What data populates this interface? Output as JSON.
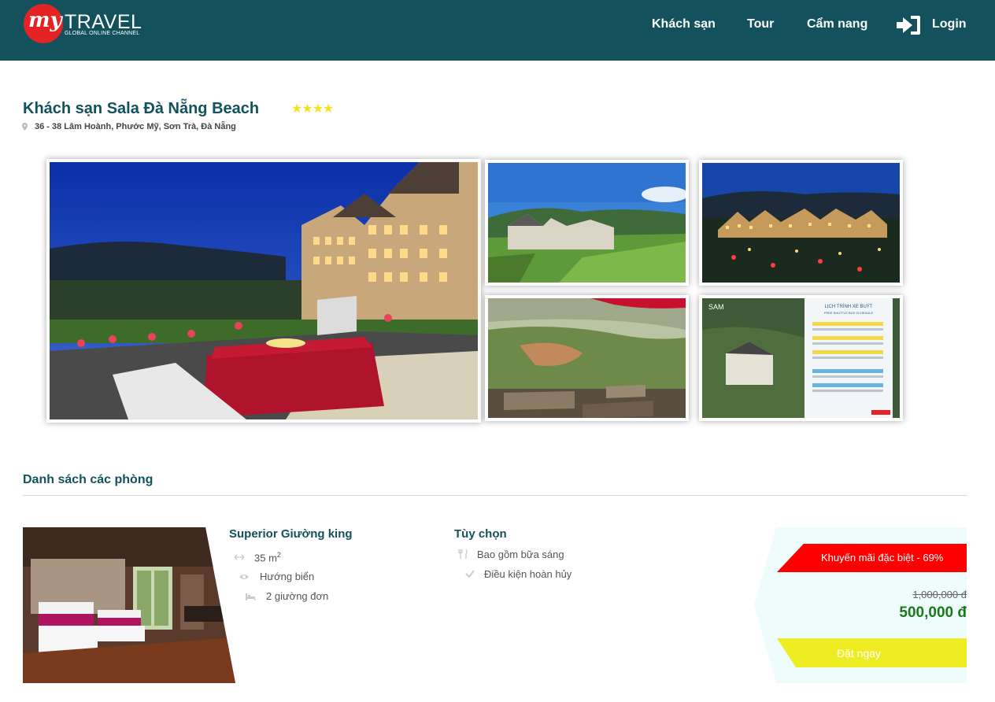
{
  "header": {
    "logo": {
      "my": "my",
      "travel": "TRAVEL",
      "tagline": "GLOBAL ONLINE CHANNEL"
    },
    "nav": {
      "hotels": "Khách sạn",
      "tours": "Tour",
      "guide": "Cẩm nang",
      "login": "Login"
    },
    "colors": {
      "bar": "#13525c",
      "logo_circle": "#e52325"
    }
  },
  "hotel": {
    "name": "Khách sạn Sala Đà Nẵng Beach",
    "stars": 4,
    "stars_text": "★★★★",
    "address": "36 - 38 Lâm Hoành, Phước Mỹ, Sơn Trà, Đà Nẵng"
  },
  "gallery": {
    "sign_title": "LỊCH TRÌNH XE BUÝT",
    "sign_subtitle": "FREE SHUTTLE BUS SCHEDULE",
    "sam_logo": "SAM"
  },
  "rooms": {
    "section_title": "Danh sách các phòng",
    "items": [
      {
        "name": "Superior Giường king",
        "area": "35 m",
        "area_sup": "2",
        "view": "Hướng biển",
        "beds": "2 giường đơn",
        "options_title": "Tùy chọn",
        "options": [
          "Bao gồm bữa sáng",
          "Điều kiện hoàn hủy"
        ],
        "promo": "Khuyến mãi đặc biệt - 69%",
        "old_price": "1,000,000 đ",
        "new_price": "500,000 đ",
        "book_label": "Đặt ngay"
      }
    ]
  },
  "colors": {
    "accent": "#13525c",
    "promo": "#ff0000",
    "price": "#1a7a1a",
    "book": "#eded22",
    "price_bg": "#eefcfc"
  }
}
